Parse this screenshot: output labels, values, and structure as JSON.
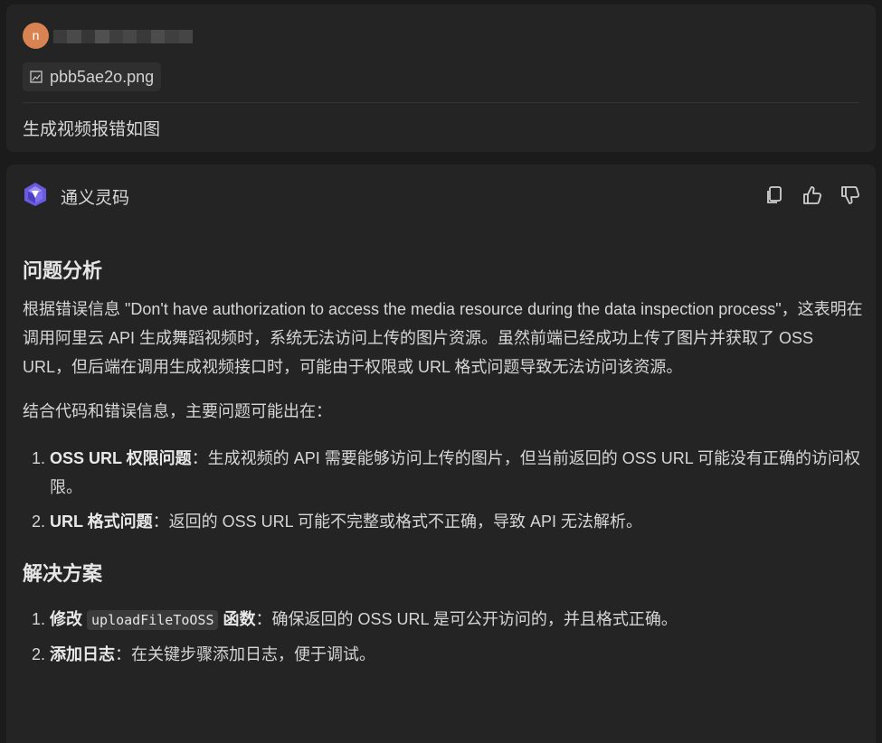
{
  "user": {
    "avatar_letter": "n",
    "attachment": "pbb5ae2o.png",
    "message": "生成视频报错如图"
  },
  "assistant": {
    "name": "通义灵码",
    "analysis": {
      "heading": "问题分析",
      "para1": "根据错误信息 \"Don't have authorization to access the media resource during the data inspection process\"，这表明在调用阿里云 API 生成舞蹈视频时，系统无法访问上传的图片资源。虽然前端已经成功上传了图片并获取了 OSS URL，但后端在调用生成视频接口时，可能由于权限或 URL 格式问题导致无法访问该资源。",
      "para2": "结合代码和错误信息，主要问题可能出在：",
      "items": [
        {
          "bold": "OSS URL 权限问题",
          "text": "：生成视频的 API 需要能够访问上传的图片，但当前返回的 OSS URL 可能没有正确的访问权限。"
        },
        {
          "bold": "URL 格式问题",
          "text": "：返回的 OSS URL 可能不完整或格式不正确，导致 API 无法解析。"
        }
      ]
    },
    "solution": {
      "heading": "解决方案",
      "items": [
        {
          "bold_pre": "修改",
          "code": "uploadFileToOSS",
          "bold_post": "函数",
          "text": "：确保返回的 OSS URL 是可公开访问的，并且格式正确。"
        },
        {
          "bold": "添加日志",
          "text": "：在关键步骤添加日志，便于调试。"
        }
      ]
    }
  }
}
